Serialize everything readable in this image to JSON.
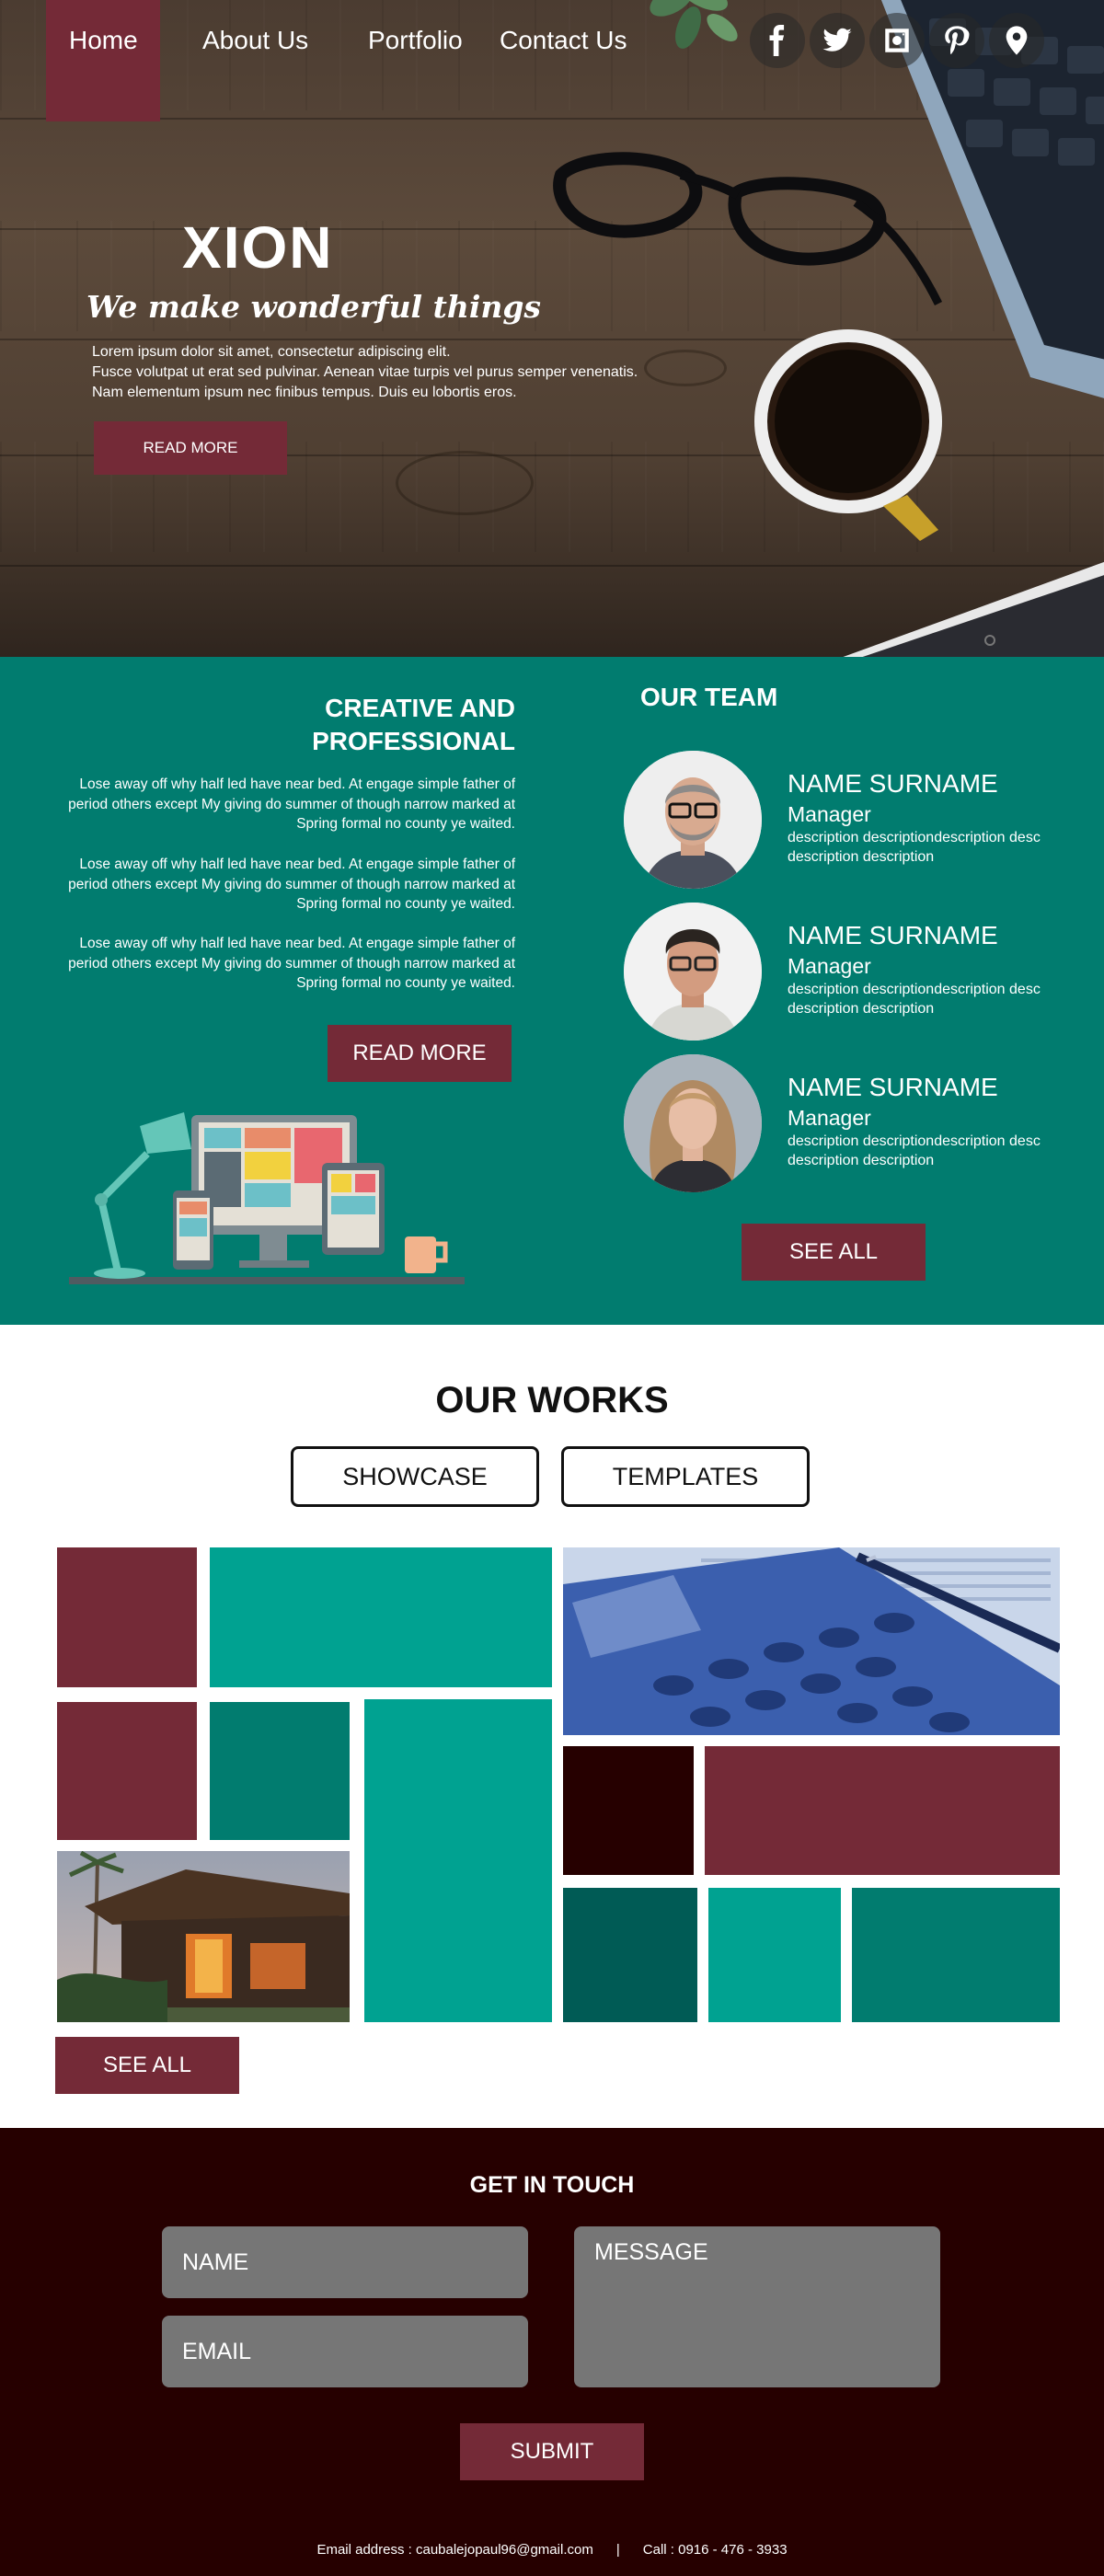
{
  "nav": {
    "home": "Home",
    "about": "About Us",
    "portfolio": "Portfolio",
    "contact": "Contact Us",
    "active_color": "#742a37"
  },
  "social": [
    "facebook-icon",
    "twitter-icon",
    "instagram-icon",
    "pinterest-icon",
    "map-pin-icon"
  ],
  "hero": {
    "title": "XION",
    "tagline": "We make wonderful things",
    "text_line1": "Lorem ipsum dolor sit amet, consectetur adipiscing elit.",
    "text_line2": "Fusce volutpat ut erat sed pulvinar. Aenean vitae turpis vel purus semper venenatis.",
    "text_line3": "Nam elementum ipsum nec finibus tempus. Duis eu lobortis eros.",
    "button": "READ MORE"
  },
  "about": {
    "title_line1": "CREATIVE AND",
    "title_line2": "PROFESSIONAL",
    "paragraphs": [
      "Lose away off why half led have near bed. At engage simple father of period others except My giving do summer of though narrow marked at  Spring formal no county ye waited.",
      "Lose away off why half led have near bed. At engage simple father of period others except My giving do summer of though narrow marked at  Spring formal no county ye waited.",
      "Lose away off why half led have near bed. At engage simple father of period others except My giving do summer of though narrow marked at  Spring formal no county ye waited."
    ],
    "button": "READ MORE"
  },
  "team": {
    "title": "OUR TEAM",
    "members": [
      {
        "name": "NAME SURNAME",
        "role": "Manager",
        "description": "description descriptiondescription desc description description"
      },
      {
        "name": "NAME SURNAME",
        "role": "Manager",
        "description": "description descriptiondescription desc description description"
      },
      {
        "name": "NAME SURNAME",
        "role": "Manager",
        "description": "description descriptiondescription desc description description"
      }
    ],
    "button": "SEE ALL"
  },
  "works": {
    "title": "OUR WORKS",
    "filters": [
      "SHOWCASE",
      "TEMPLATES"
    ],
    "button": "SEE ALL"
  },
  "contact": {
    "title": "GET IN TOUCH",
    "name_placeholder": "NAME",
    "email_placeholder": "EMAIL",
    "message_placeholder": "MESSAGE",
    "submit": "SUBMIT",
    "email_text": "Email address : caubalejopaul96@gmail.com",
    "separator": "|",
    "phone_text": "Call : 0916 - 476 - 3933"
  },
  "colors": {
    "maroon": "#742a37",
    "teal": "#017c6f",
    "bright_teal": "#00a291",
    "dark_teal": "#005b55",
    "footer_bg": "#260000",
    "input_gray": "#767676"
  }
}
